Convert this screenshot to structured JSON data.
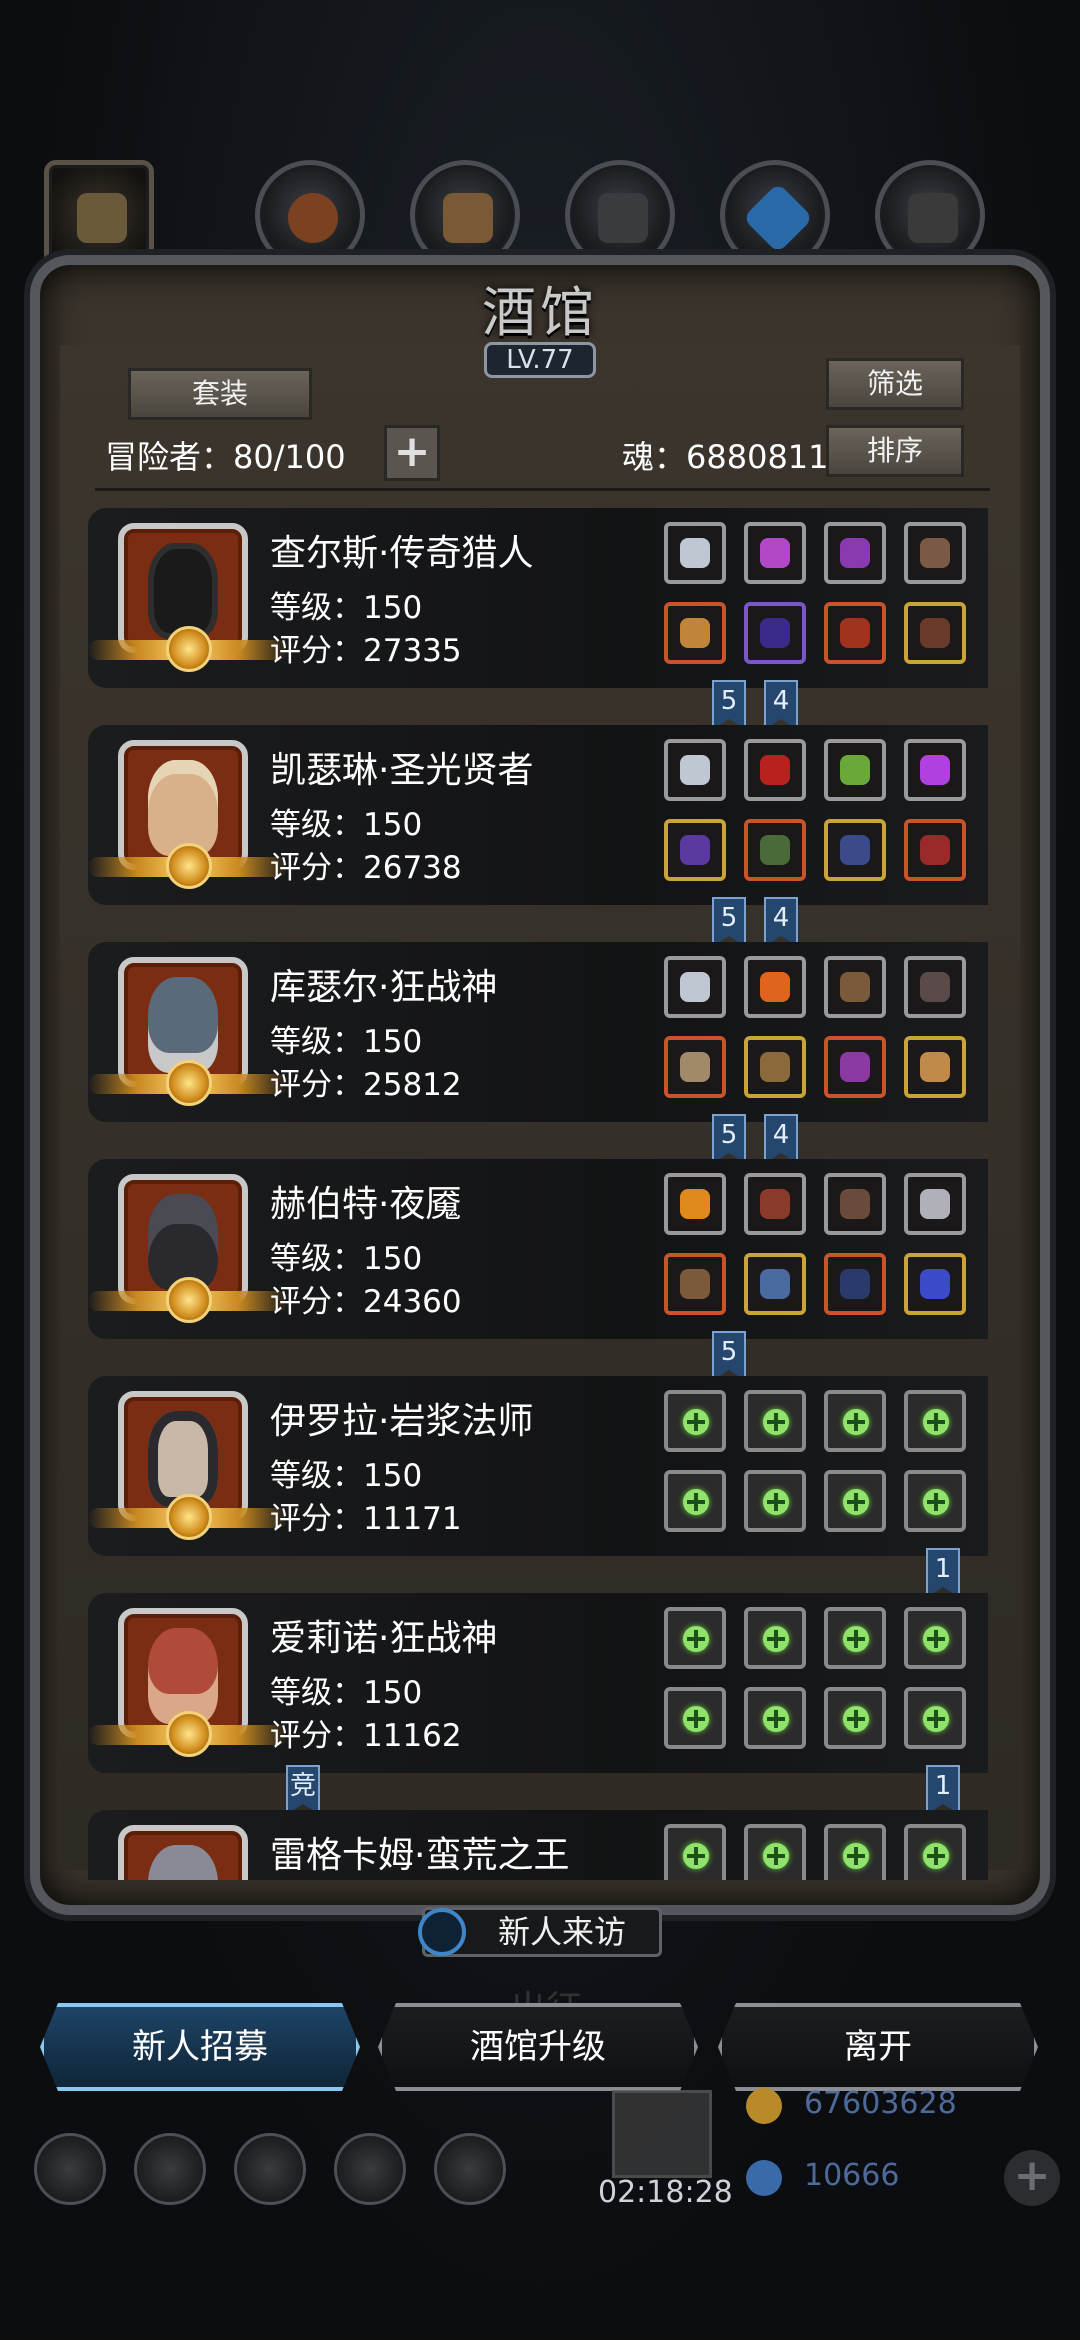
{
  "header": {
    "title": "酒馆",
    "level": "LV.77",
    "suit_label": "套装",
    "filter_label": "筛选",
    "sort_label": "排序",
    "adventurers_text": "冒险者：80/100",
    "soul_text": "魂：6880811"
  },
  "heroes": [
    {
      "name": "查尔斯·传奇猎人",
      "level": "等级：150",
      "score": "评分：27335",
      "ribbons": [
        "5",
        "4"
      ]
    },
    {
      "name": "凯瑟琳·圣光贤者",
      "level": "等级：150",
      "score": "评分：26738",
      "ribbons": [
        "5",
        "4"
      ]
    },
    {
      "name": "库瑟尔·狂战神",
      "level": "等级：150",
      "score": "评分：25812",
      "ribbons": [
        "5",
        "4"
      ]
    },
    {
      "name": "赫伯特·夜魇",
      "level": "等级：150",
      "score": "评分：24360",
      "ribbons": [
        "5"
      ]
    },
    {
      "name": "伊罗拉·岩浆法师",
      "level": "等级：150",
      "score": "评分：11171",
      "ribbons": [
        "1"
      ]
    },
    {
      "name": "爱莉诺·狂战神",
      "level": "等级：150",
      "score": "评分：11162",
      "ribbons": [
        "竞",
        "1"
      ]
    },
    {
      "name": "雷格卡姆·蛮荒之王"
    }
  ],
  "visitor_label": "新人来访",
  "buttons": {
    "recruit": "新人招募",
    "upgrade": "酒馆升级",
    "leave": "离开"
  },
  "bottom": {
    "timer": "02:18:28",
    "gold": "67603628",
    "gems": "10666",
    "ghost_label": "出征"
  },
  "colors": {
    "slot_gold": "#c9a537",
    "slot_red": "#c9542a",
    "ribbon_blue": "#25466d",
    "empty_plus": "#8fe36a"
  }
}
